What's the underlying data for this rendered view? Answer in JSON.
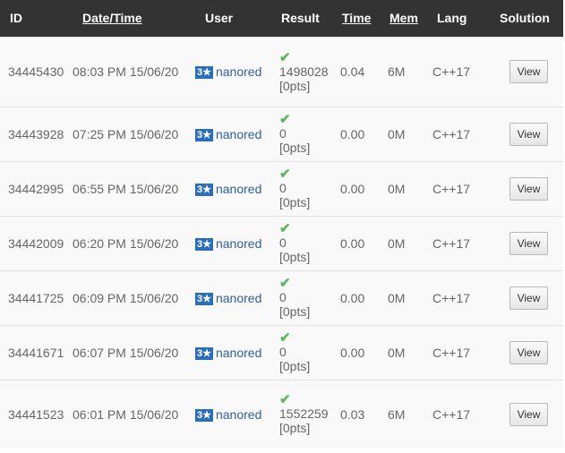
{
  "header": {
    "id": "ID",
    "datetime": "Date/Time",
    "user": "User",
    "result": "Result",
    "time": "Time",
    "mem": "Mem",
    "lang": "Lang",
    "solution": "Solution"
  },
  "colors": {
    "header_bg": "#333333",
    "row_bg": "#f9f9f9",
    "accepted": "#5cb85c",
    "badge": "#2a6ebb",
    "user_link": "#31609a"
  },
  "rows": [
    {
      "id": "34445430",
      "datetime": "08:03 PM 15/06/20",
      "badge": "3★",
      "user": "nanored",
      "check": "✔",
      "score": "1498028",
      "pts": "[0pts]",
      "time": "0.04",
      "mem": "6M",
      "lang": "C++17",
      "button": "View"
    },
    {
      "id": "34443928",
      "datetime": "07:25 PM 15/06/20",
      "badge": "3★",
      "user": "nanored",
      "check": "✔",
      "score": "0",
      "pts": "[0pts]",
      "time": "0.00",
      "mem": "0M",
      "lang": "C++17",
      "button": "View"
    },
    {
      "id": "34442995",
      "datetime": "06:55 PM 15/06/20",
      "badge": "3★",
      "user": "nanored",
      "check": "✔",
      "score": "0",
      "pts": "[0pts]",
      "time": "0.00",
      "mem": "0M",
      "lang": "C++17",
      "button": "View"
    },
    {
      "id": "34442009",
      "datetime": "06:20 PM 15/06/20",
      "badge": "3★",
      "user": "nanored",
      "check": "✔",
      "score": "0",
      "pts": "[0pts]",
      "time": "0.00",
      "mem": "0M",
      "lang": "C++17",
      "button": "View"
    },
    {
      "id": "34441725",
      "datetime": "06:09 PM 15/06/20",
      "badge": "3★",
      "user": "nanored",
      "check": "✔",
      "score": "0",
      "pts": "[0pts]",
      "time": "0.00",
      "mem": "0M",
      "lang": "C++17",
      "button": "View"
    },
    {
      "id": "34441671",
      "datetime": "06:07 PM 15/06/20",
      "badge": "3★",
      "user": "nanored",
      "check": "✔",
      "score": "0",
      "pts": "[0pts]",
      "time": "0.00",
      "mem": "0M",
      "lang": "C++17",
      "button": "View"
    },
    {
      "id": "34441523",
      "datetime": "06:01 PM 15/06/20",
      "badge": "3★",
      "user": "nanored",
      "check": "✔",
      "score": "1552259",
      "pts": "[0pts]",
      "time": "0.03",
      "mem": "6M",
      "lang": "C++17",
      "button": "View"
    }
  ]
}
